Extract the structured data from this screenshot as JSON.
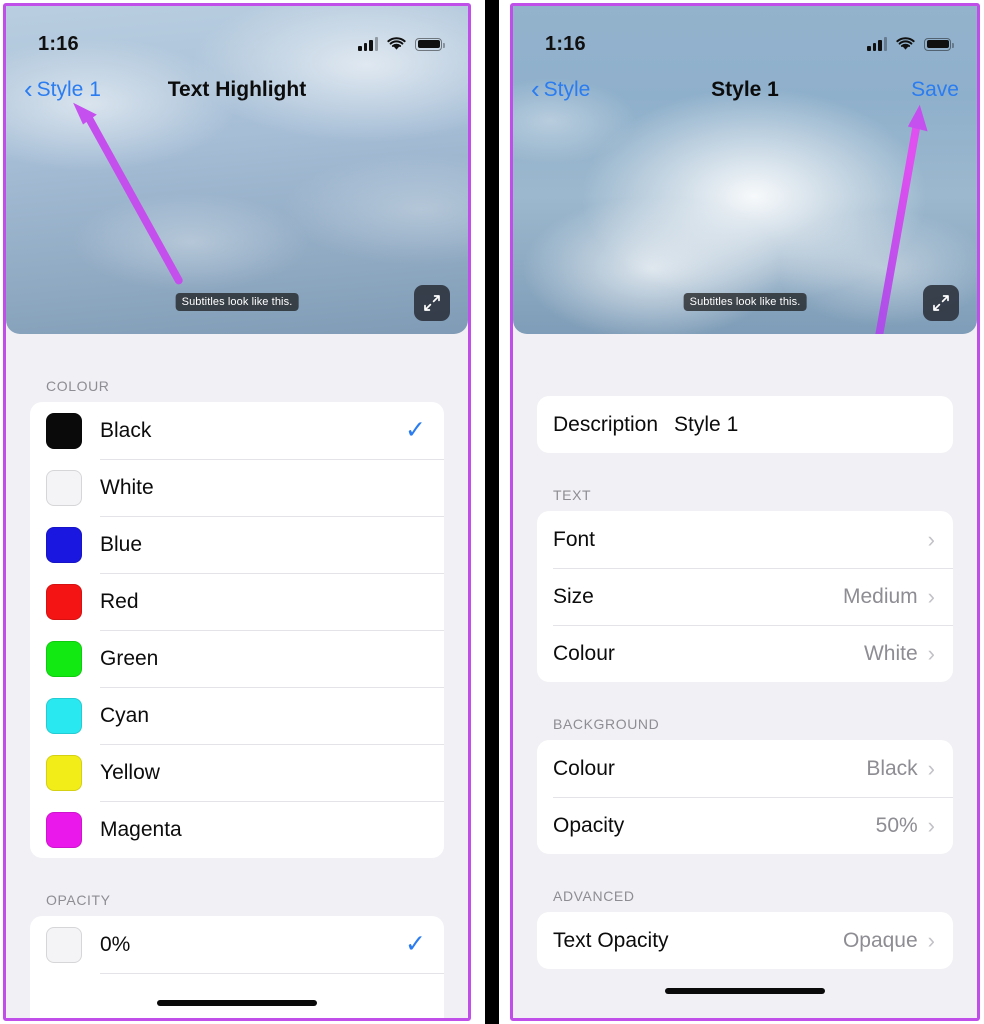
{
  "annotation": {
    "border_color": "#bf4fe8",
    "arrow_color": "#c64ff0",
    "left_arrow_target": "Style 1 back button",
    "right_arrow_target": "Save button"
  },
  "left_panel": {
    "status": {
      "time": "1:16",
      "cellular_icon": "cellular-bars-icon",
      "wifi_icon": "wifi-icon",
      "battery_icon": "battery-icon"
    },
    "nav": {
      "back_label": "Style 1",
      "back_icon": "chevron-left-icon",
      "title": "Text Highlight"
    },
    "preview": {
      "subtitle_sample": "Subtitles look like this.",
      "expand_icon": "expand-arrows-icon"
    },
    "sections": [
      {
        "header": "COLOUR",
        "rows": [
          {
            "label": "Black",
            "swatch": "#0a0a0a",
            "checked": true
          },
          {
            "label": "White",
            "swatch": "#f4f4f6",
            "checked": false
          },
          {
            "label": "Blue",
            "swatch": "#1a17e0",
            "checked": false
          },
          {
            "label": "Red",
            "swatch": "#f41414",
            "checked": false
          },
          {
            "label": "Green",
            "swatch": "#12e812",
            "checked": false
          },
          {
            "label": "Cyan",
            "swatch": "#2ae8f0",
            "checked": false
          },
          {
            "label": "Yellow",
            "swatch": "#f2ed18",
            "checked": false
          },
          {
            "label": "Magenta",
            "swatch": "#ea18ea",
            "checked": false
          }
        ]
      },
      {
        "header": "OPACITY",
        "rows": [
          {
            "label": "0%",
            "swatch": "#f4f4f6",
            "checked": true
          }
        ]
      }
    ]
  },
  "right_panel": {
    "status": {
      "time": "1:16",
      "cellular_icon": "cellular-bars-icon",
      "wifi_icon": "wifi-icon",
      "battery_icon": "battery-icon"
    },
    "nav": {
      "back_label": "Style",
      "back_icon": "chevron-left-icon",
      "title": "Style 1",
      "save_label": "Save"
    },
    "preview": {
      "subtitle_sample": "Subtitles look like this.",
      "expand_icon": "expand-arrows-icon"
    },
    "description": {
      "label": "Description",
      "value": "Style 1"
    },
    "sections": [
      {
        "header": "TEXT",
        "rows": [
          {
            "label": "Font",
            "value": "",
            "chevron": "chevron-right-icon"
          },
          {
            "label": "Size",
            "value": "Medium",
            "chevron": "chevron-right-icon"
          },
          {
            "label": "Colour",
            "value": "White",
            "chevron": "chevron-right-icon"
          }
        ]
      },
      {
        "header": "BACKGROUND",
        "rows": [
          {
            "label": "Colour",
            "value": "Black",
            "chevron": "chevron-right-icon"
          },
          {
            "label": "Opacity",
            "value": "50%",
            "chevron": "chevron-right-icon"
          }
        ]
      },
      {
        "header": "ADVANCED",
        "rows": [
          {
            "label": "Text Opacity",
            "value": "Opaque",
            "chevron": "chevron-right-icon"
          }
        ]
      }
    ]
  }
}
